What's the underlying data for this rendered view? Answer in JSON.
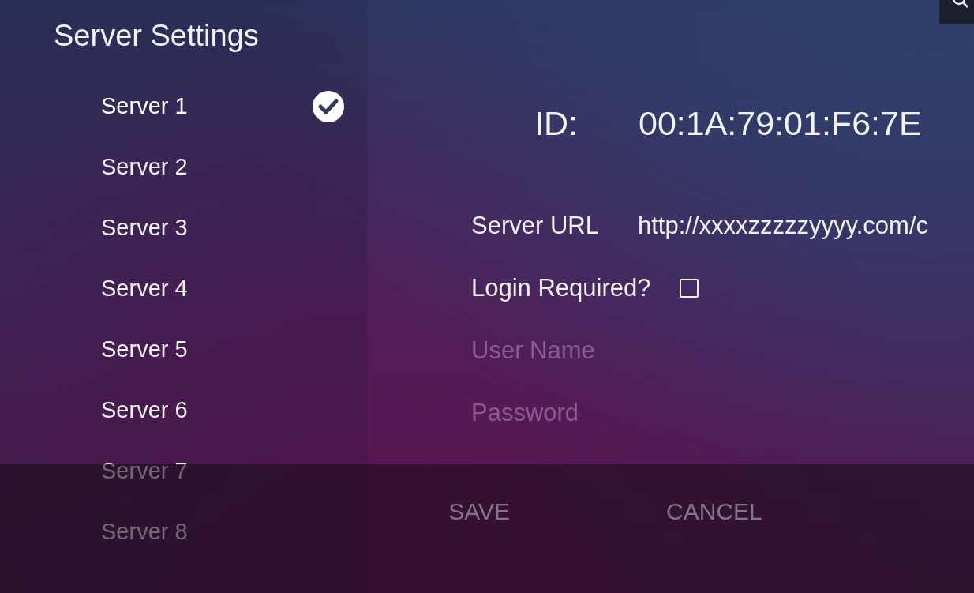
{
  "title": "Server Settings",
  "servers": [
    {
      "label": "Server 1",
      "selected": true
    },
    {
      "label": "Server 2",
      "selected": false
    },
    {
      "label": "Server 3",
      "selected": false
    },
    {
      "label": "Server 4",
      "selected": false
    },
    {
      "label": "Server 5",
      "selected": false
    },
    {
      "label": "Server 6",
      "selected": false
    },
    {
      "label": "Server 7",
      "selected": false
    },
    {
      "label": "Server 8",
      "selected": false
    }
  ],
  "id": {
    "label": "ID:",
    "value": "00:1A:79:01:F6:7E"
  },
  "server_url": {
    "label": "Server URL",
    "value": "http://xxxxzzzzzyyyy.com/c"
  },
  "login_required": {
    "label": "Login Required?",
    "checked": false
  },
  "username": {
    "placeholder": "User Name"
  },
  "password": {
    "placeholder": "Password"
  },
  "actions": [
    "SAVE",
    "CANCEL"
  ]
}
